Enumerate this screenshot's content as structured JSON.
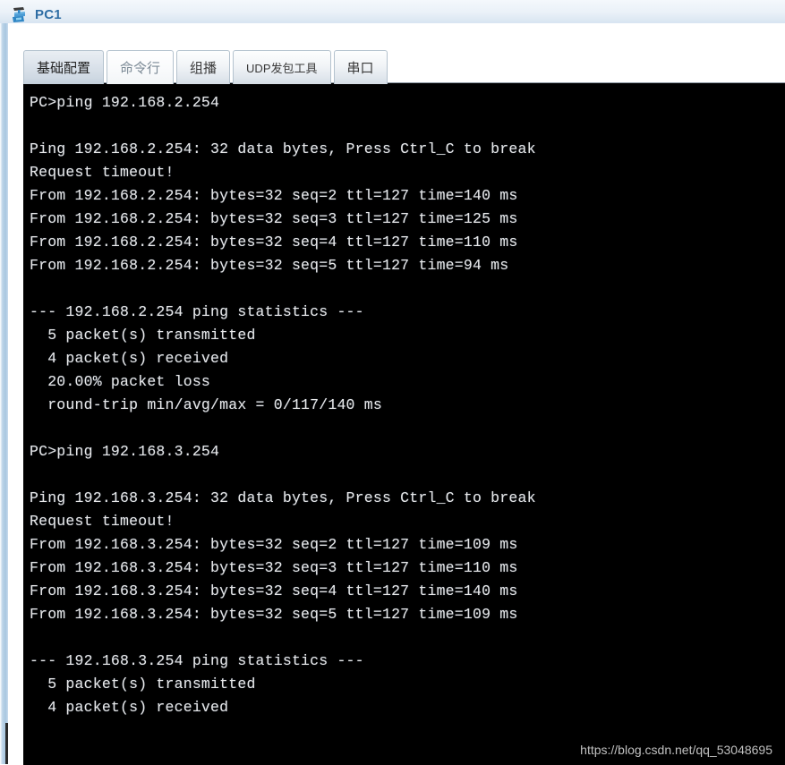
{
  "window": {
    "title": "PC1",
    "icon": "pc-device-icon",
    "title_color": "#2e6da4"
  },
  "tabs": [
    {
      "label": "基础配置",
      "state": "selected",
      "name": "tab-basic-config"
    },
    {
      "label": "命令行",
      "state": "dim",
      "name": "tab-command-line"
    },
    {
      "label": "组播",
      "state": "normal",
      "name": "tab-multicast"
    },
    {
      "label": "UDP发包工具",
      "state": "normal",
      "name": "tab-udp-packet-tool"
    },
    {
      "label": "串口",
      "state": "normal",
      "name": "tab-serial-port"
    }
  ],
  "terminal": {
    "background": "#000000",
    "foreground": "#e8e8e8",
    "lines": [
      "PC>ping 192.168.2.254",
      "",
      "Ping 192.168.2.254: 32 data bytes, Press Ctrl_C to break",
      "Request timeout!",
      "From 192.168.2.254: bytes=32 seq=2 ttl=127 time=140 ms",
      "From 192.168.2.254: bytes=32 seq=3 ttl=127 time=125 ms",
      "From 192.168.2.254: bytes=32 seq=4 ttl=127 time=110 ms",
      "From 192.168.2.254: bytes=32 seq=5 ttl=127 time=94 ms",
      "",
      "--- 192.168.2.254 ping statistics ---",
      "  5 packet(s) transmitted",
      "  4 packet(s) received",
      "  20.00% packet loss",
      "  round-trip min/avg/max = 0/117/140 ms",
      "",
      "PC>ping 192.168.3.254",
      "",
      "Ping 192.168.3.254: 32 data bytes, Press Ctrl_C to break",
      "Request timeout!",
      "From 192.168.3.254: bytes=32 seq=2 ttl=127 time=109 ms",
      "From 192.168.3.254: bytes=32 seq=3 ttl=127 time=110 ms",
      "From 192.168.3.254: bytes=32 seq=4 ttl=127 time=140 ms",
      "From 192.168.3.254: bytes=32 seq=5 ttl=127 time=109 ms",
      "",
      "--- 192.168.3.254 ping statistics ---",
      "  5 packet(s) transmitted",
      "  4 packet(s) received"
    ]
  },
  "watermark": {
    "text": "https://blog.csdn.net/qq_53048695"
  }
}
